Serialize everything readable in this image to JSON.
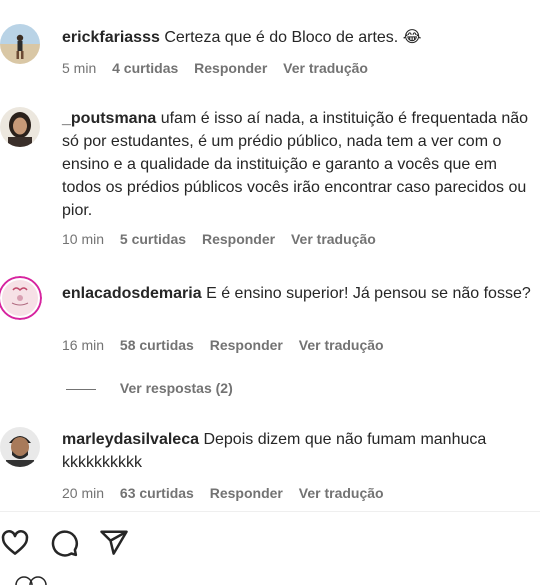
{
  "comments": [
    {
      "username": "erickfariasss",
      "text": "Certeza que é do Bloco de artes.",
      "emoji": "😂",
      "time": "5 min",
      "likes": "4 curtidas",
      "reply": "Responder",
      "translate": "Ver tradução"
    },
    {
      "username": "_poutsmana",
      "text": "ufam é isso aí nada, a instituição é frequentada não só por estudantes, é um prédio público, nada tem a ver com o ensino e a qualidade da instituição e garanto a vocês que em todos os prédios públicos vocês irão encontrar caso parecidos ou pior.",
      "time": "10 min",
      "likes": "5 curtidas",
      "reply": "Responder",
      "translate": "Ver tradução"
    },
    {
      "username": "enlacadosdemaria",
      "text": "E é ensino superior! Já pensou se não fosse?",
      "time": "16 min",
      "likes": "58 curtidas",
      "reply": "Responder",
      "translate": "Ver tradução",
      "view_replies": "Ver respostas (2)"
    },
    {
      "username": "marleydasilvaleca",
      "text": "Depois dizem que não fumam manhuca kkkkkkkkkk",
      "time": "20 min",
      "likes": "63 curtidas",
      "reply": "Responder",
      "translate": "Ver tradução"
    }
  ],
  "actions": {
    "like_icon": "heart-icon",
    "comment_icon": "comment-icon",
    "share_icon": "share-icon"
  }
}
